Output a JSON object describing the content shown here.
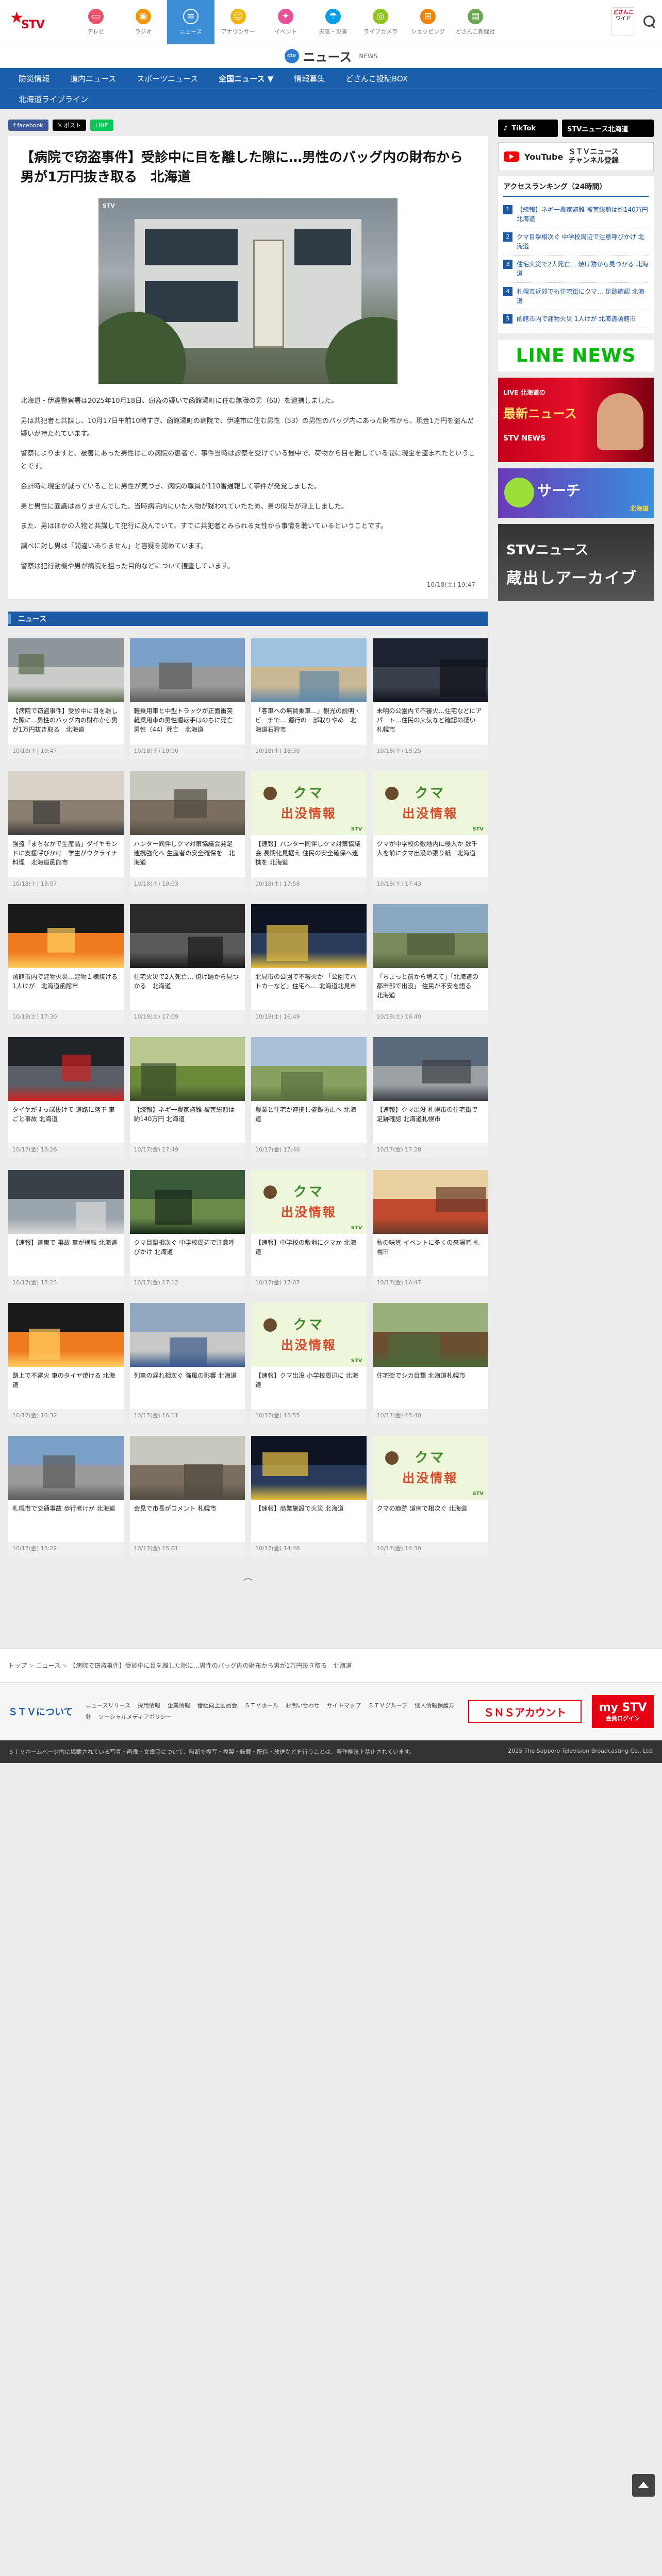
{
  "topnav": {
    "items": [
      {
        "label": "テレビ",
        "icon": "tv-icon",
        "color": "#e9546b"
      },
      {
        "label": "ラジオ",
        "icon": "radio-icon",
        "color": "#f39800"
      },
      {
        "label": "ニュース",
        "icon": "news-icon",
        "color": "#3c8fd6",
        "active": true
      },
      {
        "label": "アナウンサー",
        "icon": "announcer-icon",
        "color": "#f5b400"
      },
      {
        "label": "イベント",
        "icon": "event-icon",
        "color": "#e85298"
      },
      {
        "label": "天気・災害",
        "icon": "weather-icon",
        "color": "#00a0e9"
      },
      {
        "label": "ライブカメラ",
        "icon": "camera-icon",
        "color": "#8fc31f"
      },
      {
        "label": "ショッピング",
        "icon": "shopping-icon",
        "color": "#f08300"
      },
      {
        "label": "どさんこ新聞社",
        "icon": "newspaper-icon",
        "color": "#6aa84f"
      }
    ],
    "logo_text": "STV",
    "promo": {
      "line1": "どさんこ",
      "line2": "ワイド"
    }
  },
  "section_header": {
    "badge": "stv",
    "title": "ニュース",
    "subtitle": "NEWS"
  },
  "catnav": {
    "row1": [
      "防災情報",
      "道内ニュース",
      "スポーツニュース",
      "全国ニュース ▼",
      "情報募集",
      "どさんこ投稿BOX"
    ],
    "row2": [
      "北海道ライブライン"
    ]
  },
  "share": {
    "facebook": "f facebook",
    "x": "𝕏 ポスト",
    "line": "LINE"
  },
  "article": {
    "headline": "【病院で窃盗事件】受診中に目を離した隙に…男性のバッグ内の財布から男が1万円抜き取る　北海道",
    "hero_badge": "STV",
    "paragraphs": [
      "北海道・伊達警察署は2025年10月18日、窃盗の疑いで函館湯町に住む無職の男（60）を逮捕しました。",
      "男は共犯者と共謀し、10月17日午前10時すぎ、函館湯町の病院で、伊達市に住む男性（53）の男性のバッグ内にあった財布から、現金1万円を盗んだ疑いが持たれています。",
      "警察によりますと、被害にあった男性はこの病院の患者で、事件当時は診察を受けている最中で、荷物から目を離している間に現金を盗まれたということです。",
      "会計時に現金が減っていることに男性が気づき、病院の職員が110番通報して事件が発覚しました。",
      "男と男性に面識はありませんでした。当時病院内にいた人物が疑われていたため、男の関与が浮上しました。",
      "また、男はほかの人物と共謀して犯行に及んでいて、すでに共犯者とみられる女性から事情を聴いているということです。",
      "調べに対し男は「間違いありません」と容疑を認めています。",
      "警察は犯行動機や男が病院を狙った目的などについて捜査しています。"
    ],
    "date": "10/18(土) 19:47"
  },
  "news_section_label": "ニュース",
  "cards": [
    {
      "title": "【病院で窃盗事件】受診中に目を離した隙に…男性のバッグ内の財布から男が1万円抜き取る　北海道",
      "date": "10/18(土) 19:47",
      "thumb": "clinic"
    },
    {
      "title": "軽乗用車と中型トラックが正面衝突 軽乗用車の男性運転手はのちに死亡 男性（44）死亡　北海道",
      "date": "10/18(土) 19:00",
      "thumb": "road"
    },
    {
      "title": "「客車への無賃乗車…」観光の説明・ビーチで… 運行の一部取りやめ　北海道石狩市",
      "date": "10/18(土) 18:30",
      "thumb": "coast"
    },
    {
      "title": "未明の公園内で不審火…住宅などにアパート…住民の火気など確認の疑い　札幌市",
      "date": "10/18(土) 18:25",
      "thumb": "park"
    },
    {
      "title": "強盗「まちなかで生産品」ダイヤモンドに支援呼びかけ　学生がウクライナ料理　北海道函館市",
      "date": "10/18(土) 18:07",
      "thumb": "people"
    },
    {
      "title": "ハンター同伴しクマ対策協議会発足 連携強化へ 生産者の安全確保を　北海道",
      "date": "10/18(土) 18:03",
      "thumb": "meeting"
    },
    {
      "title": "【速報】ハンター同伴しクマ対策協議会 長期化見据え 住民の安全確保へ連携を 北海道",
      "date": "10/18(土) 17:58",
      "thumb": "bear"
    },
    {
      "title": "クマが中学校の敷地内に侵入か 数千人を前にクマ出没の張り紙　北海道",
      "date": "10/18(土) 17:43",
      "thumb": "bear"
    },
    {
      "title": "函館市内で建物火災…建物１棟焼ける 1人けが　北海道函館市",
      "date": "10/18(土) 17:30",
      "thumb": "fire"
    },
    {
      "title": "住宅火災で2人死亡… 焼け跡から見つかる　北海道",
      "date": "10/18(土) 17:09",
      "thumb": "fire2"
    },
    {
      "title": "北見市の公園で不審火か 「公園でパトカーなど」住宅へ… 北海道北見市",
      "date": "10/18(土) 16:49",
      "thumb": "night"
    },
    {
      "title": "「ちょっと前から増えて」「北海道の都市部で出没」 住民が不安を語る　北海道",
      "date": "10/18(土) 16:49",
      "thumb": "mountain"
    },
    {
      "title": "タイヤがすっぽ抜けて 道路に落下 車ごと事故 北海道",
      "date": "10/17(金) 18:26",
      "thumb": "car"
    },
    {
      "title": "【続報】ネギ一農家盗難 被害総額は約140万円 北海道",
      "date": "10/17(金) 17:49",
      "thumb": "crop"
    },
    {
      "title": "農業と住宅が連携し盗難防止へ 北海道",
      "date": "10/17(金) 17:46",
      "thumb": "field"
    },
    {
      "title": "【速報】クマ出没 札幌市の住宅街で足跡確認 北海道札幌市",
      "date": "10/17(金) 17:28",
      "thumb": "street"
    },
    {
      "title": "【速報】道東で 事故 車が横転 北海道",
      "date": "10/17(金) 17:23",
      "thumb": "crash"
    },
    {
      "title": "クマ目撃相次ぐ 中学校周辺で注意呼びかけ 北海道",
      "date": "10/17(金) 17:12",
      "thumb": "forest"
    },
    {
      "title": "【速報】中学校の敷地にクマか 北海道",
      "date": "10/17(金) 17:07",
      "thumb": "bear"
    },
    {
      "title": "秋の味覚 イベントに多くの来場者 札幌市",
      "date": "10/17(金) 16:47",
      "thumb": "festival"
    },
    {
      "title": "路上で不審火 車のタイヤ焼ける 北海道",
      "date": "10/17(金) 16:32",
      "thumb": "fire"
    },
    {
      "title": "列車の遅れ相次ぐ 強風の影響 北海道",
      "date": "10/17(金) 16:11",
      "thumb": "train"
    },
    {
      "title": "【速報】クマ出没 小学校周辺に 北海道",
      "date": "10/17(金) 15:55",
      "thumb": "bear"
    },
    {
      "title": "住宅街でシカ目撃 北海道札幌市",
      "date": "10/17(金) 15:40",
      "thumb": "deer"
    },
    {
      "title": "札幌市で交通事故 歩行者けが 北海道",
      "date": "10/17(金) 15:22",
      "thumb": "road"
    },
    {
      "title": "会見で市長がコメント 札幌市",
      "date": "10/17(金) 15:01",
      "thumb": "meeting"
    },
    {
      "title": "【速報】商業施設で火災 北海道",
      "date": "10/17(金) 14:48",
      "thumb": "night"
    },
    {
      "title": "クマの痕跡 道南で相次ぐ 北海道",
      "date": "10/17(金) 14:30",
      "thumb": "bear"
    }
  ],
  "loading_text": "⌒",
  "side": {
    "tiktok": "TikTok",
    "tiktok_name": "STVニュース北海道",
    "youtube_word": "YouTube",
    "youtube_name": "ＳＴＶニュース\nチャンネル登録",
    "ranking_title": "アクセスランキング（24時間）",
    "ranking": [
      "【続報】ネギ一農家盗難 被害総額は約140万円 北海道",
      "クマ目撃相次ぐ 中学校周辺で注意呼びかけ 北海道",
      "住宅火災で2人死亡… 焼け跡から見つかる 北海道",
      "札幌市近郊でも住宅街にクマ… 足跡確認 北海道",
      "函館市内で建物火災 1人けが 北海道函館市"
    ],
    "linenews": "LINE NEWS",
    "b1_t1": "LIVE 北海道の",
    "b1_t2": "最新ニュース",
    "b1_t3": "STV NEWS",
    "b2_t": "サーチ",
    "b2_t2": "北海道",
    "b3_t": "STVニュース",
    "b3_t2": "蔵出しアーカイブ"
  },
  "breadcrumb": [
    "トップ",
    "ニュース",
    "【病院で窃盗事件】受診中に目を離した隙に…男性のバッグ内の財布から男が1万円抜き取る　北海道"
  ],
  "footer": {
    "logo": "ＳＴＶについて",
    "links": [
      "ニュースリリース",
      "採用情報",
      "企業情報",
      "番組向上委員会",
      "ＳＴＶホール",
      "お問い合わせ",
      "サイトマップ",
      "ＳＴＶグループ",
      "個人情報保護方針",
      "ソーシャルメディアポリシー"
    ],
    "sns": "ＳＮＳアカウント",
    "my": "my STV",
    "my_sub": "会員ログイン"
  },
  "copyright": "ＳＴＶホームページ内に掲載されている写真・画像・文章等について、無断で複写・複製・転載・配信・放送などを行うことは、著作権法上禁止されています。",
  "copyright_right": "2025 The Sapporo Television Broadcasting Co., Ltd."
}
